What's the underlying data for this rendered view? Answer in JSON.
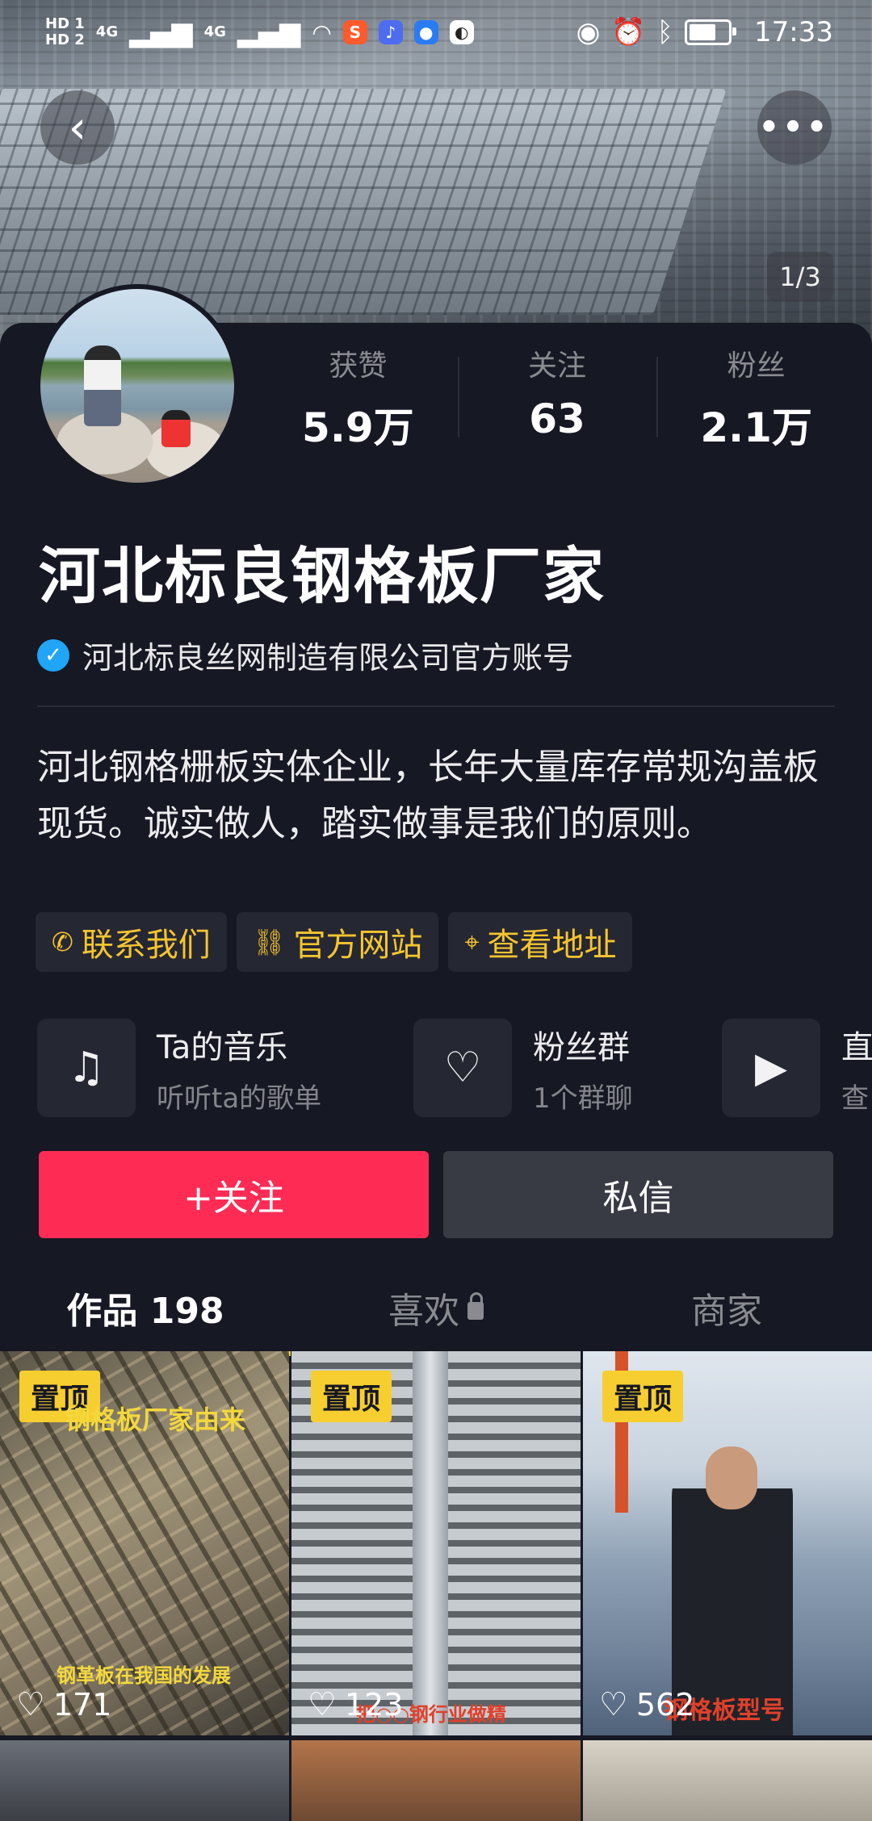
{
  "status_bar": {
    "left": {
      "hd1": "HD 1",
      "hd2": "HD 2",
      "net1": "4G",
      "net2": "4G"
    },
    "time": "17:33"
  },
  "banner": {
    "page_indicator": "1/3"
  },
  "profile": {
    "name": "河北标良钢格板厂家",
    "verified_text": "河北标良丝网制造有限公司官方账号",
    "stats": [
      {
        "label": "获赞",
        "value": "5.9万"
      },
      {
        "label": "关注",
        "value": "63"
      },
      {
        "label": "粉丝",
        "value": "2.1万"
      }
    ],
    "bio": "河北钢格栅板实体企业，长年大量库存常规沟盖板现货。诚实做人，踏实做事是我们的原则。"
  },
  "links": [
    {
      "label": "联系我们",
      "icon": "phone-icon"
    },
    {
      "label": "官方网站",
      "icon": "link-icon"
    },
    {
      "label": "查看地址",
      "icon": "location-icon"
    }
  ],
  "services": [
    {
      "title": "Ta的音乐",
      "subtitle": "听听ta的歌单",
      "icon": "music-icon"
    },
    {
      "title": "粉丝群",
      "subtitle": "1个群聊",
      "icon": "fan-group-icon"
    },
    {
      "title": "直",
      "subtitle": "查",
      "icon": "live-tv-icon"
    }
  ],
  "actions": {
    "follow": "+关注",
    "message": "私信"
  },
  "tabs": [
    {
      "label": "作品 198"
    },
    {
      "label": "喜欢"
    },
    {
      "label": "商家"
    }
  ],
  "videos": [
    {
      "pin": "置顶",
      "caption_top": "钢格板厂家由来",
      "caption_bottom": "钢革板在我国的发展",
      "likes": "171"
    },
    {
      "pin": "置顶",
      "caption_bottom": "把○○钢行业做精",
      "likes": "123"
    },
    {
      "pin": "置顶",
      "caption_bottom": "钢格板型号",
      "likes": "562"
    }
  ],
  "colors": {
    "accent_follow": "#fe2c55",
    "accent_yellow": "#f7ce2f",
    "background": "#161823",
    "verify_blue": "#20a5f7"
  }
}
